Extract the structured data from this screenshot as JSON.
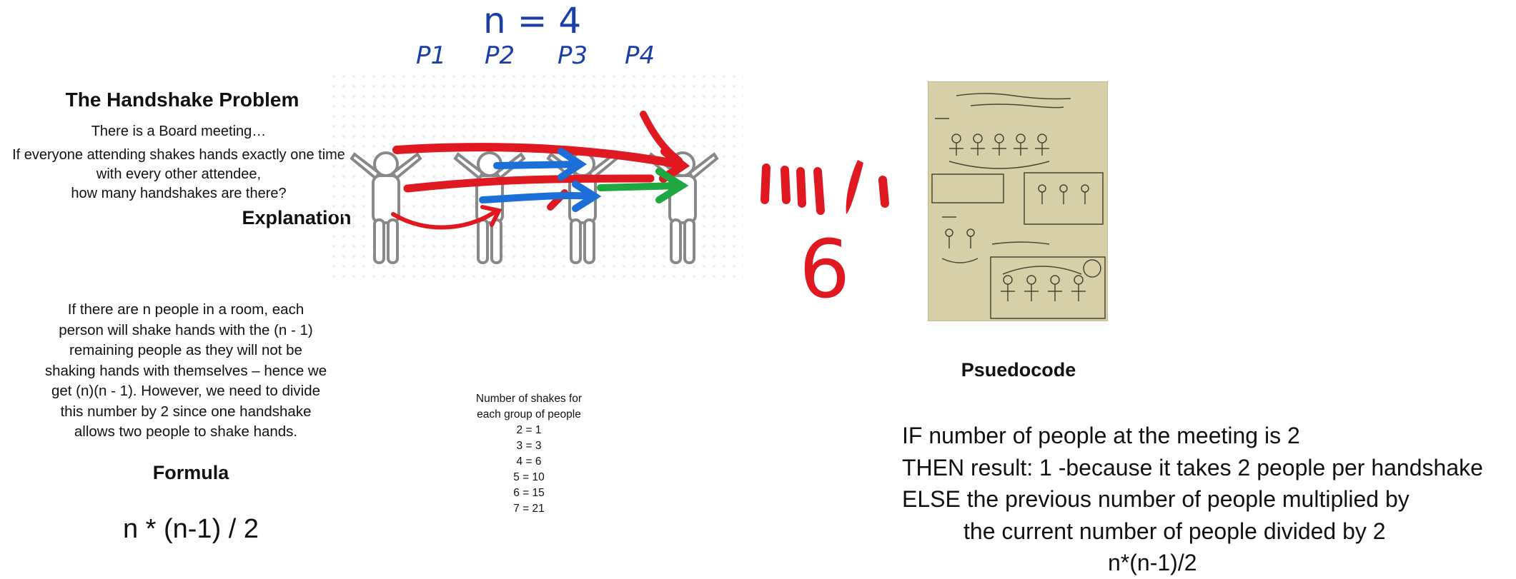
{
  "header": {
    "title": "The Handshake Problem",
    "subtitle": "There is a Board meeting…",
    "question_lines": [
      "If everyone attending shakes hands exactly one time",
      "with every other attendee,",
      "how many handshakes are there?"
    ]
  },
  "explanation": {
    "heading": "Explanation",
    "lines": [
      "If there are n people in a room, each",
      "person will shake hands with the (n - 1)",
      "remaining people as they will not be",
      "shaking hands with themselves – hence we",
      "get (n)(n - 1). However, we need to divide",
      "this number by 2 since one handshake",
      "allows two people to shake hands."
    ]
  },
  "formula": {
    "heading": "Formula",
    "expression": "n * (n-1) / 2"
  },
  "shakes_table": {
    "heading_lines": [
      "Number of shakes for",
      "each group of people"
    ],
    "rows": [
      "2 = 1",
      "3 = 3",
      "4 = 6",
      "5 = 10",
      "6 = 15",
      "7 = 21"
    ]
  },
  "annotations": {
    "n_equals": "n = 4",
    "persons": [
      "P1",
      "P2",
      "P3",
      "P4"
    ],
    "answer": "6"
  },
  "pseudocode": {
    "heading": "Psuedocode",
    "lines": [
      "IF number of people at the meeting is 2",
      "THEN result: 1 -because it takes 2 people per handshake",
      "ELSE the previous number of people multiplied by",
      "the current number of people divided by 2",
      "n*(n-1)/2"
    ]
  },
  "colors": {
    "red": "#e0181f",
    "blue": "#1c6fd8",
    "green": "#1fa83f",
    "ink_blue": "#1b3fa8",
    "paper": "#d7cfa8"
  }
}
